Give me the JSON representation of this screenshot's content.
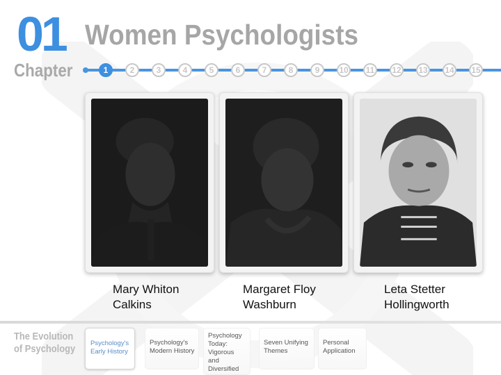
{
  "header": {
    "chapter_number": "01",
    "chapter_word": "Chapter",
    "title": "Women Psychologists"
  },
  "chapter_nav": {
    "active": 1,
    "items": [
      "1",
      "2",
      "3",
      "4",
      "5",
      "6",
      "7",
      "8",
      "9",
      "10",
      "11",
      "12",
      "13",
      "14",
      "15"
    ]
  },
  "psychologists": [
    {
      "name": "Mary Whiton\nCalkins"
    },
    {
      "name": "Margaret Floy\nWashburn"
    },
    {
      "name": "Leta Stetter\nHollingworth"
    }
  ],
  "section": {
    "label": "The Evolution\nof Psychology",
    "tabs": [
      {
        "label": "Psychology's\nEarly History",
        "active": true
      },
      {
        "label": "Psychology's\nModern History",
        "active": false
      },
      {
        "label": "Psychology\nToday:\nVigorous\nand\nDiversified",
        "active": false
      },
      {
        "label": "Seven Unifying\nThemes",
        "active": false
      },
      {
        "label": "Personal\nApplication",
        "active": false
      }
    ]
  },
  "colors": {
    "accent": "#3d8fe0",
    "heading_gray": "#a6a6a6",
    "active_tab_text": "#5a8dc8"
  }
}
